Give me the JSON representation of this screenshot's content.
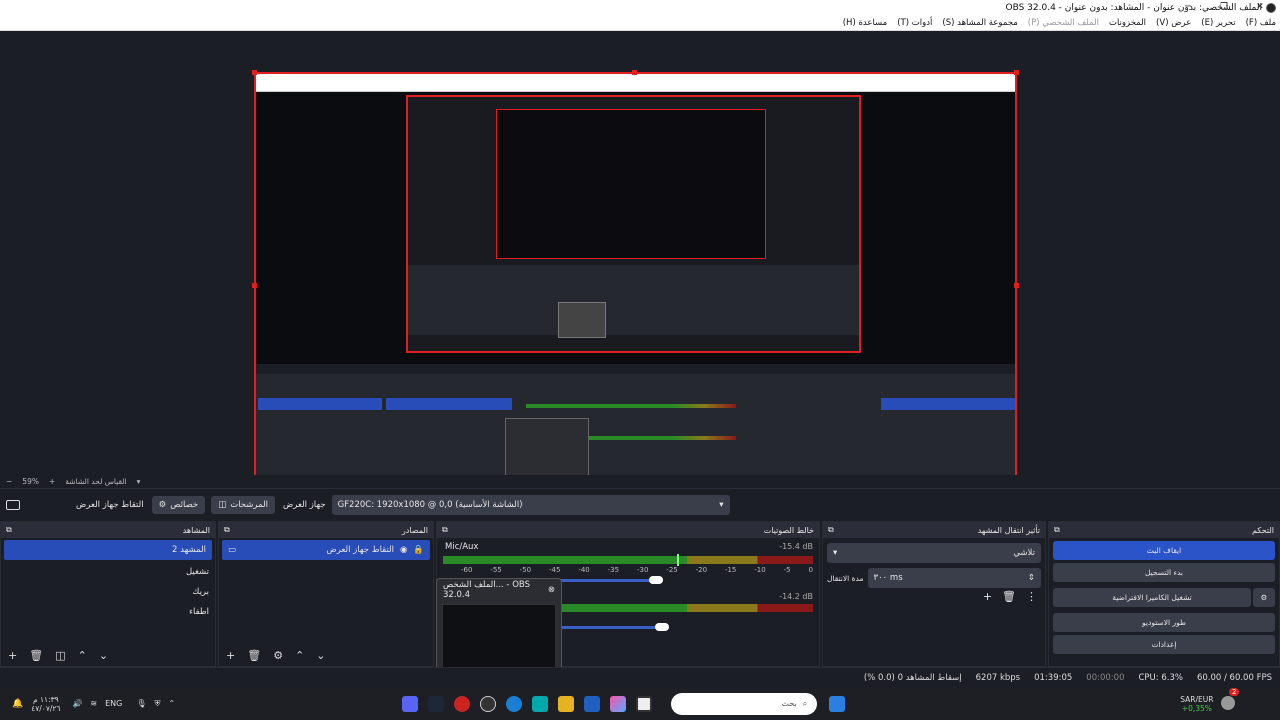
{
  "window": {
    "title": "الملف الشخصي: بدون عنوان - المشاهد: بدون عنوان - OBS 32.0.4"
  },
  "menu": {
    "file": "ملف (F)",
    "edit": "تحرير (E)",
    "view": "عرض (V)",
    "docks": "المخزونات",
    "profile": "الملف الشخصي (P)",
    "scene_collection": "مجموعة المشاهد (S)",
    "tools": "أدوات (T)",
    "help": "مساعدة (H)"
  },
  "zoom": {
    "minus": "−",
    "value": "59%",
    "plus": "+",
    "fit_label": "القياس لحد الشاشة"
  },
  "source_bar": {
    "label": "التقاط جهاز العرض",
    "properties": "خصائص",
    "filters": "المرشحات",
    "display_label": "جهاز العرض",
    "display_value": "GF220C: 1920x1080 @ 0,0 (الشاشة الأساسية)"
  },
  "scenes": {
    "header": "المشاهد",
    "items": [
      "المشهد 2",
      "تشغيل",
      "بريك",
      "اطفاء"
    ]
  },
  "sources": {
    "header": "المصادر",
    "items": [
      "التقاط جهاز العرض"
    ]
  },
  "mixer": {
    "header": "خالط الصوتيات",
    "channels": [
      {
        "name": "Mic/Aux",
        "db": "-15.4 dB"
      },
      {
        "name": "",
        "db": "-14.2 dB"
      }
    ],
    "scale": [
      "-60",
      "-55",
      "-50",
      "-45",
      "-40",
      "-35",
      "-30",
      "-25",
      "-20",
      "-15",
      "-10",
      "-5",
      "0"
    ]
  },
  "transitions": {
    "header": "تأثير انتقال المشهد",
    "type": "تلاشي",
    "duration_label": "مدة الانتقال",
    "duration_value": "٣٠٠ ms"
  },
  "controls": {
    "header": "التحكم",
    "stop_stream": "ايقاف البث",
    "start_record": "بدء التسجيل",
    "virtual_cam": "تشغيل الكاميرا الافتراضية",
    "studio_mode": "طور الاستوديو",
    "settings": "إعدادات"
  },
  "status": {
    "dropped": "إسقاط المشاهد 0 (0.0 %)",
    "bitrate": "6207 kbps",
    "stream_time": "01:39:05",
    "record_time": "00:00:00",
    "cpu": "CPU: 6.3%",
    "fps": "60.00 / 60.00 FPS"
  },
  "tooltip": {
    "title": "الملف الشخص... - OBS 32.0.4"
  },
  "taskbar": {
    "time": "١١:٣٩ م",
    "date": "٤٧/٠٧/٢٦",
    "lang": "ENG",
    "search_placeholder": "بحث",
    "ticker": "SAR/EUR",
    "ticker_value": "+0,35%",
    "badge": "2"
  },
  "colors": {
    "accent": "#284cb8",
    "border_red": "#e02020",
    "meter_green": "#2a8a2a",
    "meter_yellow": "#8a7a1a",
    "meter_red": "#8a1a1a"
  }
}
